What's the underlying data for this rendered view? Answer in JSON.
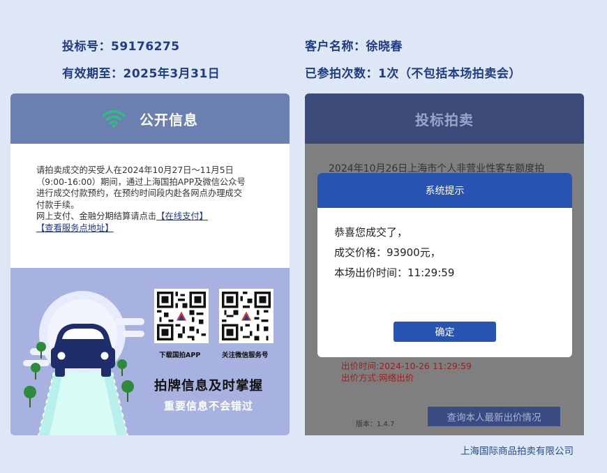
{
  "header": {
    "bid_number": "投标号：59176275",
    "valid_until": "有效期至：2025年3月31日",
    "customer_name": "客户名称：徐晓春",
    "auction_count": "已参拍次数：1次（不包括本场拍卖会）"
  },
  "left_panel": {
    "title": "公开信息",
    "notice_lines": [
      "请拍卖成交的买受人在2024年10月27日～11月5日",
      "（9:00-16:00）期间，通过上海国拍APP及微信公众号",
      "进行成交付款预约，在预约时间段内赴各网点办理成交",
      "付款手续。"
    ],
    "payment_text": "网上支付、金融分期结算请点击",
    "online_pay_link": "【在线支付】",
    "service_link": "【查看服务点地址】",
    "promo": {
      "qr1_caption": "下载国拍APP",
      "qr2_caption": "关注微信服务号",
      "headline": "拍牌信息及时掌握",
      "subline": "重要信息不会错过"
    }
  },
  "right_panel": {
    "title": "投标拍卖",
    "background_line": "2024年10月26日上海市个人非营业性客车额度拍",
    "bid_time": "出价时间:2024-10-26 11:29:59",
    "bid_method": "出价方式:网络出价",
    "version": "版本：1.4.7",
    "query_button": "查询本人最新出价情况"
  },
  "modal": {
    "title": "系统提示",
    "line1": "恭喜您成交了，",
    "line2": "成交价格：93900元，",
    "line3": "本场出价时间：11:29:59",
    "ok_button": "确定"
  },
  "footer": {
    "company": "上海国际商品拍卖有限公司"
  },
  "colors": {
    "page_bg": "#dde7f5",
    "header_text": "#1f3c84",
    "left_header_bg": "#6b7fb0",
    "promo_bg": "#a7b2e0",
    "wifi_icon": "#2fc07a",
    "modal_header_bg": "#2853b2",
    "bid_info_text": "#9c2020"
  }
}
